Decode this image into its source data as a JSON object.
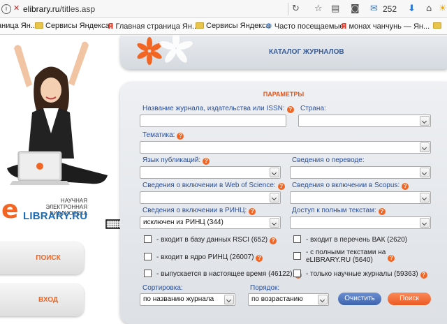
{
  "browser": {
    "url_domain": "elibrary.ru",
    "url_path": "/titles.asp",
    "mail_count": "252"
  },
  "bookmarks": [
    {
      "label": "аница Ян...",
      "icon": "yandex-icon"
    },
    {
      "label": "Сервисы Яндекса",
      "icon": "folder-icon"
    },
    {
      "label": "Главная страница Ян...",
      "icon": "yandex-icon"
    },
    {
      "label": "Сервисы Яндекса",
      "icon": "folder-icon"
    },
    {
      "label": "Часто посещаемые",
      "icon": "globe-icon"
    },
    {
      "label": "монах чанчунь — Ян...",
      "icon": "yandex-icon"
    }
  ],
  "sidebar": {
    "logo_line1": "НАУЧНАЯ ЭЛЕКТРОННАЯ",
    "logo_line2": "БИБЛИОТЕКА",
    "logo_e": "e",
    "logo_name": "LIBRARY.RU",
    "search_btn": "ПОИСК",
    "login_btn": "ВХОД"
  },
  "header": {
    "title": "КАТАЛОГ ЖУРНАЛОВ"
  },
  "params": {
    "title": "ПАРАМЕТРЫ",
    "journal_name_label": "Название журнала, издательства или ISSN:",
    "country_label": "Страна:",
    "topic_label": "Тематика:",
    "language_label": "Язык публикаций:",
    "translation_label": "Сведения о переводе:",
    "wos_label": "Сведения о включении в Web of Science:",
    "scopus_label": "Сведения о включении в Scopus:",
    "rinc_label": "Сведения о включении в РИНЦ:",
    "rinc_value": "исключен из РИНЦ  (344)",
    "fulltext_label": "Доступ к полным текстам:",
    "checkboxes": {
      "rsci": "- входит в базу данных RSCI (652)",
      "vak": "- входит в перечень ВАК (2620)",
      "core": "- входит в ядро РИНЦ (26007)",
      "fulltext_l1": "- с полными текстами на",
      "fulltext_l2": "eLIBRARY.RU (5640)",
      "current": "- выпускается в настоящее время (46122)",
      "scientific": "- только научные журналы (59363)"
    },
    "sort_label": "Сортировка:",
    "sort_value": "по названию журнала",
    "order_label": "Порядок:",
    "order_value": "по возрастанию",
    "clear_btn": "Очистить",
    "search_btn": "Поиск"
  },
  "colors": {
    "accent": "#f26522",
    "label_blue": "#2850a0",
    "header_blue": "#3a5a90"
  }
}
